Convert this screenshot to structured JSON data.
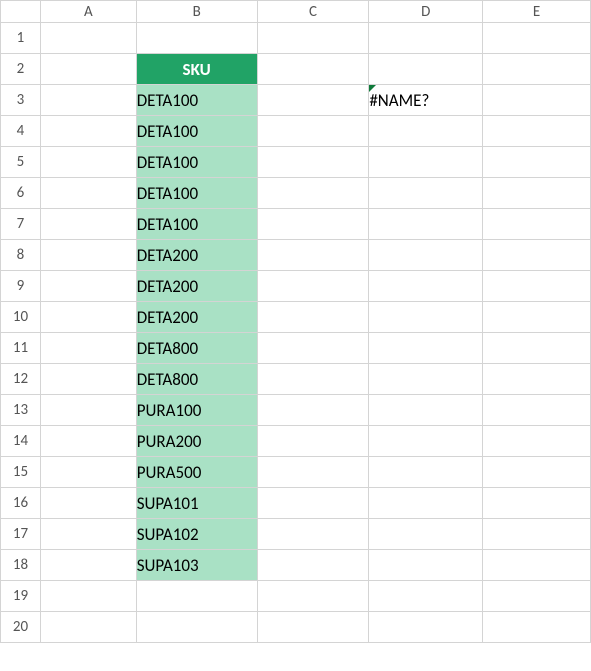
{
  "columns": [
    "A",
    "B",
    "C",
    "D",
    "E"
  ],
  "rows": [
    "1",
    "2",
    "3",
    "4",
    "5",
    "6",
    "7",
    "8",
    "9",
    "10",
    "11",
    "12",
    "13",
    "14",
    "15",
    "16",
    "17",
    "18",
    "19",
    "20"
  ],
  "sku_header": "SKU",
  "sku_values": [
    "DETA100",
    "DETA100",
    "DETA100",
    "DETA100",
    "DETA100",
    "DETA200",
    "DETA200",
    "DETA200",
    "DETA800",
    "DETA800",
    "PURA100",
    "PURA200",
    "PURA500",
    "SUPA101",
    "SUPA102",
    "SUPA103"
  ],
  "error_value": "#NAME?",
  "chart_data": {
    "type": "table",
    "title": "SKU",
    "categories": [
      "SKU"
    ],
    "values": [
      "DETA100",
      "DETA100",
      "DETA100",
      "DETA100",
      "DETA100",
      "DETA200",
      "DETA200",
      "DETA200",
      "DETA800",
      "DETA800",
      "PURA100",
      "PURA200",
      "PURA500",
      "SUPA101",
      "SUPA102",
      "SUPA103"
    ],
    "xlabel": "",
    "ylabel": ""
  }
}
